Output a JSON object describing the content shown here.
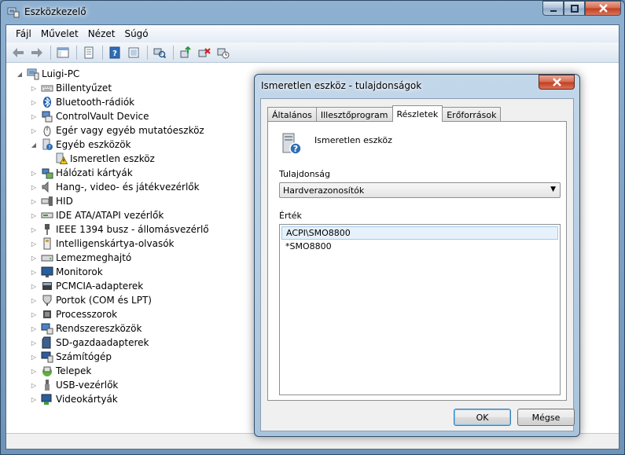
{
  "window": {
    "title": "Eszközkezelő"
  },
  "menu": [
    "Fájl",
    "Művelet",
    "Nézet",
    "Súgó"
  ],
  "tree": {
    "root": "Luigi-PC",
    "items": [
      {
        "label": "Billentyűzet",
        "icon": "keyboard-icon"
      },
      {
        "label": "Bluetooth-rádiók",
        "icon": "bluetooth-icon"
      },
      {
        "label": "ControlVault Device",
        "icon": "device-icon"
      },
      {
        "label": "Egér vagy egyéb mutatóeszköz",
        "icon": "mouse-icon"
      },
      {
        "label": "Egyéb eszközök",
        "icon": "unknown-device-icon",
        "expanded": true,
        "children": [
          {
            "label": "Ismeretlen eszköz",
            "icon": "warning-device-icon"
          }
        ]
      },
      {
        "label": "Hálózati kártyák",
        "icon": "network-icon"
      },
      {
        "label": "Hang-, video- és játékvezérlők",
        "icon": "speaker-icon"
      },
      {
        "label": "HID",
        "icon": "hid-icon"
      },
      {
        "label": "IDE ATA/ATAPI vezérlők",
        "icon": "ide-icon"
      },
      {
        "label": "IEEE 1394 busz - állomásvezérlő",
        "icon": "plug-icon"
      },
      {
        "label": "Intelligenskártya-olvasók",
        "icon": "smartcard-icon"
      },
      {
        "label": "Lemezmeghajtó",
        "icon": "disk-icon"
      },
      {
        "label": "Monitorok",
        "icon": "monitor-icon"
      },
      {
        "label": "PCMCIA-adapterek",
        "icon": "pcmcia-icon"
      },
      {
        "label": "Portok (COM és LPT)",
        "icon": "port-icon"
      },
      {
        "label": "Processzorok",
        "icon": "cpu-icon"
      },
      {
        "label": "Rendszereszközök",
        "icon": "system-icon"
      },
      {
        "label": "SD-gazdaadapterek",
        "icon": "sd-icon"
      },
      {
        "label": "Számítógép",
        "icon": "computer-icon"
      },
      {
        "label": "Telepek",
        "icon": "battery-icon"
      },
      {
        "label": "USB-vezérlők",
        "icon": "usb-icon"
      },
      {
        "label": "Videokártyák",
        "icon": "display-adapter-icon"
      }
    ]
  },
  "dialog": {
    "title": "Ismeretlen eszköz - tulajdonságok",
    "tabs": [
      "Általános",
      "Illesztőprogram",
      "Részletek",
      "Erőforrások"
    ],
    "active_tab": "Részletek",
    "device_name": "Ismeretlen eszköz",
    "property_label": "Tulajdonság",
    "property_value": "Hardverazonosítók",
    "value_label": "Érték",
    "values": [
      "ACPI\\SMO8800",
      "*SMO8800"
    ],
    "ok_label": "OK",
    "cancel_label": "Mégse"
  }
}
